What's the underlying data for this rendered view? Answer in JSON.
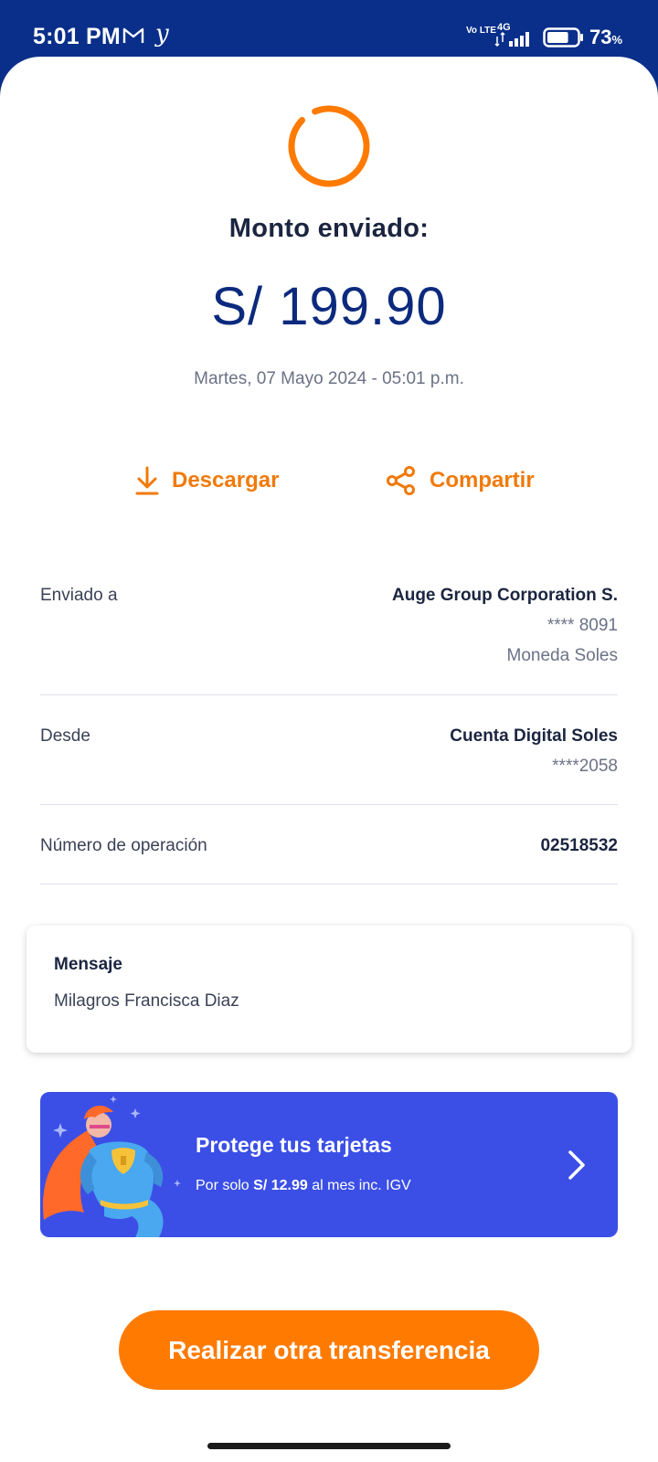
{
  "status_bar": {
    "time": "5:01 PM",
    "network_volte": "Vo LTE",
    "network_type": "4G",
    "battery_percent": "73",
    "battery_unit": "%",
    "battery_level": 0.73,
    "icons": [
      "gmail-icon",
      "y-app-icon",
      "signal-icon",
      "battery-icon"
    ]
  },
  "receipt": {
    "title": "Monto enviado:",
    "amount": "S/ 199.90",
    "date": "Martes, 07 Mayo 2024 - 05:01 p.m."
  },
  "actions": {
    "download_label": "Descargar",
    "share_label": "Compartir"
  },
  "details": {
    "sent_to": {
      "label": "Enviado a",
      "name": "Auge Group Corporation S.",
      "account": "**** 8091",
      "currency": "Moneda Soles"
    },
    "from": {
      "label": "Desde",
      "account_name": "Cuenta Digital Soles",
      "account_number": "****2058"
    },
    "operation": {
      "label": "Número de operación",
      "number": "02518532"
    }
  },
  "message": {
    "title": "Mensaje",
    "text": "Milagros Francisca Diaz"
  },
  "promo": {
    "title": "Protege tus tarjetas",
    "sub_prefix": "Por solo",
    "price": "S/ 12.99",
    "sub_suffix": "al mes inc. IGV"
  },
  "cta": {
    "label": "Realizar otra transferencia"
  },
  "colors": {
    "brand_blue": "#0a2f8a",
    "accent_orange": "#ff7a00",
    "promo_blue": "#3b4fe6"
  }
}
